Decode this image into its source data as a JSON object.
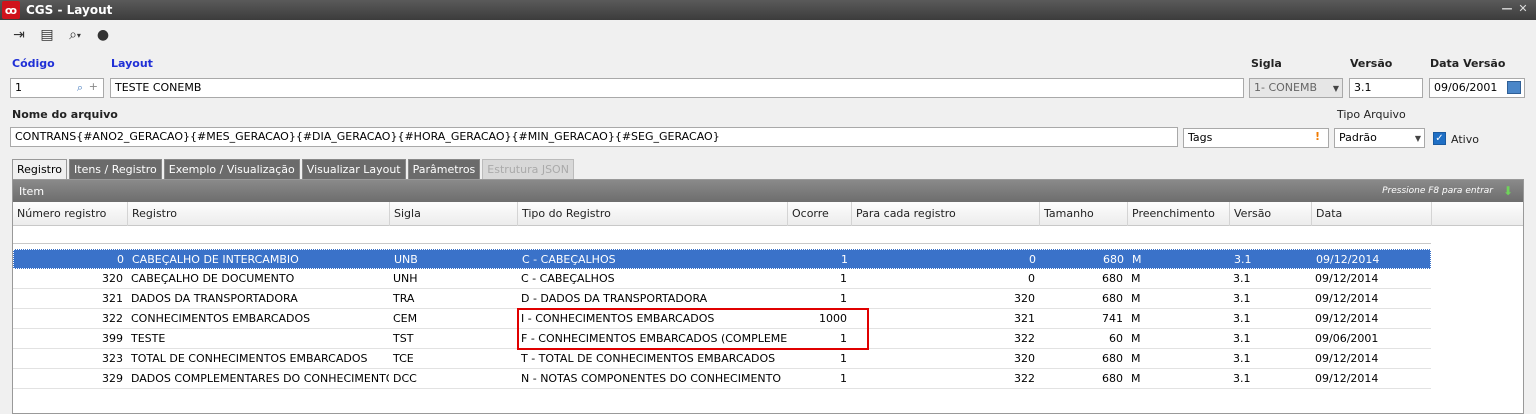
{
  "window": {
    "title": "CGS - Layout"
  },
  "toolbar": {
    "buttons": [
      {
        "name": "exit-icon",
        "glyph": "⇥"
      },
      {
        "name": "card-icon",
        "glyph": "▤"
      },
      {
        "name": "search-icon",
        "glyph": "🔍"
      },
      {
        "name": "user-icon",
        "glyph": "👤"
      }
    ]
  },
  "form": {
    "codigo_label": "Código",
    "codigo_value": "1",
    "layout_label": "Layout",
    "layout_value": "TESTE CONEMB",
    "sigla_label": "Sigla",
    "sigla_value": "1- CONEMB",
    "versao_label": "Versão",
    "versao_value": "3.1",
    "data_versao_label": "Data Versão",
    "data_versao_value": "09/06/2001",
    "nome_arquivo_label": "Nome do arquivo",
    "nome_arquivo_value": "CONTRANS{#ANO2_GERACAO}{#MES_GERACAO}{#DIA_GERACAO}{#HORA_GERACAO}{#MIN_GERACAO}{#SEG_GERACAO}",
    "tags_value": "Tags",
    "tipo_arquivo_label": "Tipo Arquivo",
    "tipo_arquivo_value": "Padrão",
    "ativo_label": "Ativo"
  },
  "tabs": [
    {
      "label": "Registro",
      "state": "active"
    },
    {
      "label": "Itens / Registro",
      "state": "normal"
    },
    {
      "label": "Exemplo / Visualização",
      "state": "normal"
    },
    {
      "label": "Visualizar Layout",
      "state": "normal"
    },
    {
      "label": "Parâmetros",
      "state": "normal"
    },
    {
      "label": "Estrutura JSON",
      "state": "disabled"
    }
  ],
  "grid": {
    "title": "Item",
    "hint": "Pressione F8 para entrar",
    "columns": [
      "Número registro",
      "Registro",
      "Sigla",
      "Tipo do Registro",
      "Ocorre",
      "Para cada registro",
      "Tamanho",
      "Preenchimento",
      "Versão",
      "Data"
    ],
    "rows": [
      {
        "numero": "0",
        "registro": "CABEÇALHO DE INTERCAMBIO",
        "sigla": "UNB",
        "tipo": "C - CABEÇALHOS",
        "ocorre": "1",
        "para_cada": "0",
        "tamanho": "680",
        "preenchimento": "M",
        "versao": "3.1",
        "data": "09/12/2014",
        "selected": true
      },
      {
        "numero": "320",
        "registro": "CABEÇALHO DE DOCUMENTO",
        "sigla": "UNH",
        "tipo": "C - CABEÇALHOS",
        "ocorre": "1",
        "para_cada": "0",
        "tamanho": "680",
        "preenchimento": "M",
        "versao": "3.1",
        "data": "09/12/2014",
        "selected": false
      },
      {
        "numero": "321",
        "registro": "DADOS DA TRANSPORTADORA",
        "sigla": "TRA",
        "tipo": "D - DADOS DA TRANSPORTADORA",
        "ocorre": "1",
        "para_cada": "320",
        "tamanho": "680",
        "preenchimento": "M",
        "versao": "3.1",
        "data": "09/12/2014",
        "selected": false
      },
      {
        "numero": "322",
        "registro": "CONHECIMENTOS EMBARCADOS",
        "sigla": "CEM",
        "tipo": "I - CONHECIMENTOS EMBARCADOS",
        "ocorre": "1000",
        "para_cada": "321",
        "tamanho": "741",
        "preenchimento": "M",
        "versao": "3.1",
        "data": "09/12/2014",
        "selected": false
      },
      {
        "numero": "399",
        "registro": "TESTE",
        "sigla": "TST",
        "tipo": "F - CONHECIMENTOS EMBARCADOS (COMPLEMENTO)",
        "ocorre": "1",
        "para_cada": "322",
        "tamanho": "60",
        "preenchimento": "M",
        "versao": "3.1",
        "data": "09/06/2001",
        "selected": false
      },
      {
        "numero": "323",
        "registro": "TOTAL DE CONHECIMENTOS EMBARCADOS",
        "sigla": "TCE",
        "tipo": "T - TOTAL DE CONHECIMENTOS EMBARCADOS",
        "ocorre": "1",
        "para_cada": "320",
        "tamanho": "680",
        "preenchimento": "M",
        "versao": "3.1",
        "data": "09/12/2014",
        "selected": false
      },
      {
        "numero": "329",
        "registro": "DADOS COMPLEMENTARES DO CONHECIMENTO E...",
        "sigla": "DCC",
        "tipo": "N - NOTAS COMPONENTES DO CONHECIMENTO",
        "ocorre": "1",
        "para_cada": "322",
        "tamanho": "680",
        "preenchimento": "M",
        "versao": "3.1",
        "data": "09/12/2014",
        "selected": false
      }
    ]
  },
  "colors": {
    "selection": "#3a72c9",
    "highlight": "#e00000",
    "label_blue": "#1f2fd6"
  }
}
